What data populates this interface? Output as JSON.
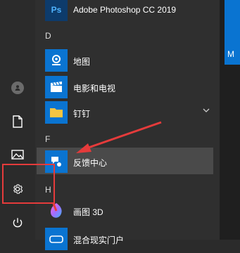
{
  "colors": {
    "accent": "#0a74d1",
    "highlight": "#4a4a4a",
    "annotation_red": "#e53b3b"
  },
  "rail": {
    "items": [
      {
        "name": "user-avatar",
        "icon": "user-icon"
      },
      {
        "name": "documents",
        "icon": "document-icon"
      },
      {
        "name": "pictures",
        "icon": "picture-icon"
      },
      {
        "name": "settings",
        "icon": "gear-icon"
      },
      {
        "name": "power",
        "icon": "power-icon"
      }
    ]
  },
  "apps": {
    "photoshop": {
      "label": "Adobe Photoshop CC 2019",
      "tile_text": "Ps"
    },
    "section_d": "D",
    "maps": {
      "label": "地图"
    },
    "movies": {
      "label": "电影和电视"
    },
    "dingtalk": {
      "label": "钉钉"
    },
    "section_f": "F",
    "feedback": {
      "label": "反馈中心"
    },
    "section_h": "H",
    "paint3d": {
      "label": "画图 3D"
    },
    "mixed_reality": {
      "label": "混合现实门户"
    }
  },
  "right_tile": {
    "letter": "M"
  }
}
